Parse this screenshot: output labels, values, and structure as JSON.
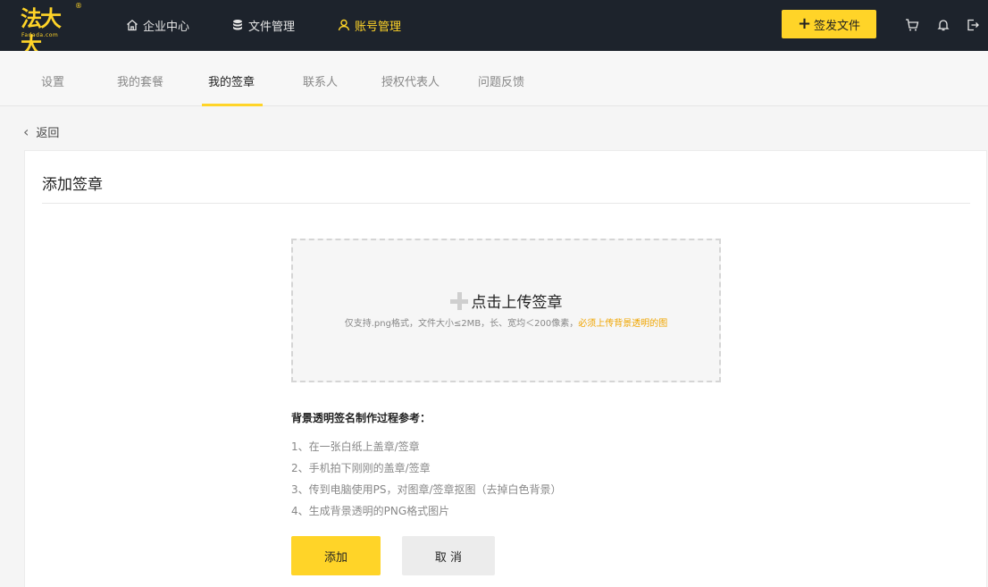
{
  "logo": {
    "text": "法大大",
    "sub": "Fadada.com",
    "reg": "®"
  },
  "topnav": {
    "items": [
      {
        "label": "企业中心",
        "icon": "home-icon"
      },
      {
        "label": "文件管理",
        "icon": "database-icon"
      },
      {
        "label": "账号管理",
        "icon": "user-icon"
      }
    ],
    "active_index": 2,
    "sign_button": "签发文件",
    "icons": [
      "cart-icon",
      "bell-icon",
      "logout-icon"
    ]
  },
  "subnav": {
    "tabs": [
      "设置",
      "我的套餐",
      "我的签章",
      "联系人",
      "授权代表人",
      "问题反馈"
    ],
    "active_index": 2
  },
  "back_label": "返回",
  "card": {
    "title": "添加签章",
    "upload": {
      "label": "点击上传签章",
      "hint": "仅支持.png格式，文件大小≤2MB，长、宽均＜200像素，",
      "hint_warning": "必须上传背景透明的图"
    },
    "guide": {
      "title": "背景透明签名制作过程参考：",
      "steps": [
        "1、在一张白纸上盖章/签章",
        "2、手机拍下刚刚的盖章/签章",
        "3、传到电脑使用PS，对图章/签章抠图（去掉白色背景）",
        "4、生成背景透明的PNG格式图片"
      ]
    },
    "buttons": {
      "add": "添加",
      "cancel": "取 消"
    }
  },
  "colors": {
    "accent": "#ffd428",
    "topbar": "#1d232c",
    "warning": "#f0a500"
  }
}
